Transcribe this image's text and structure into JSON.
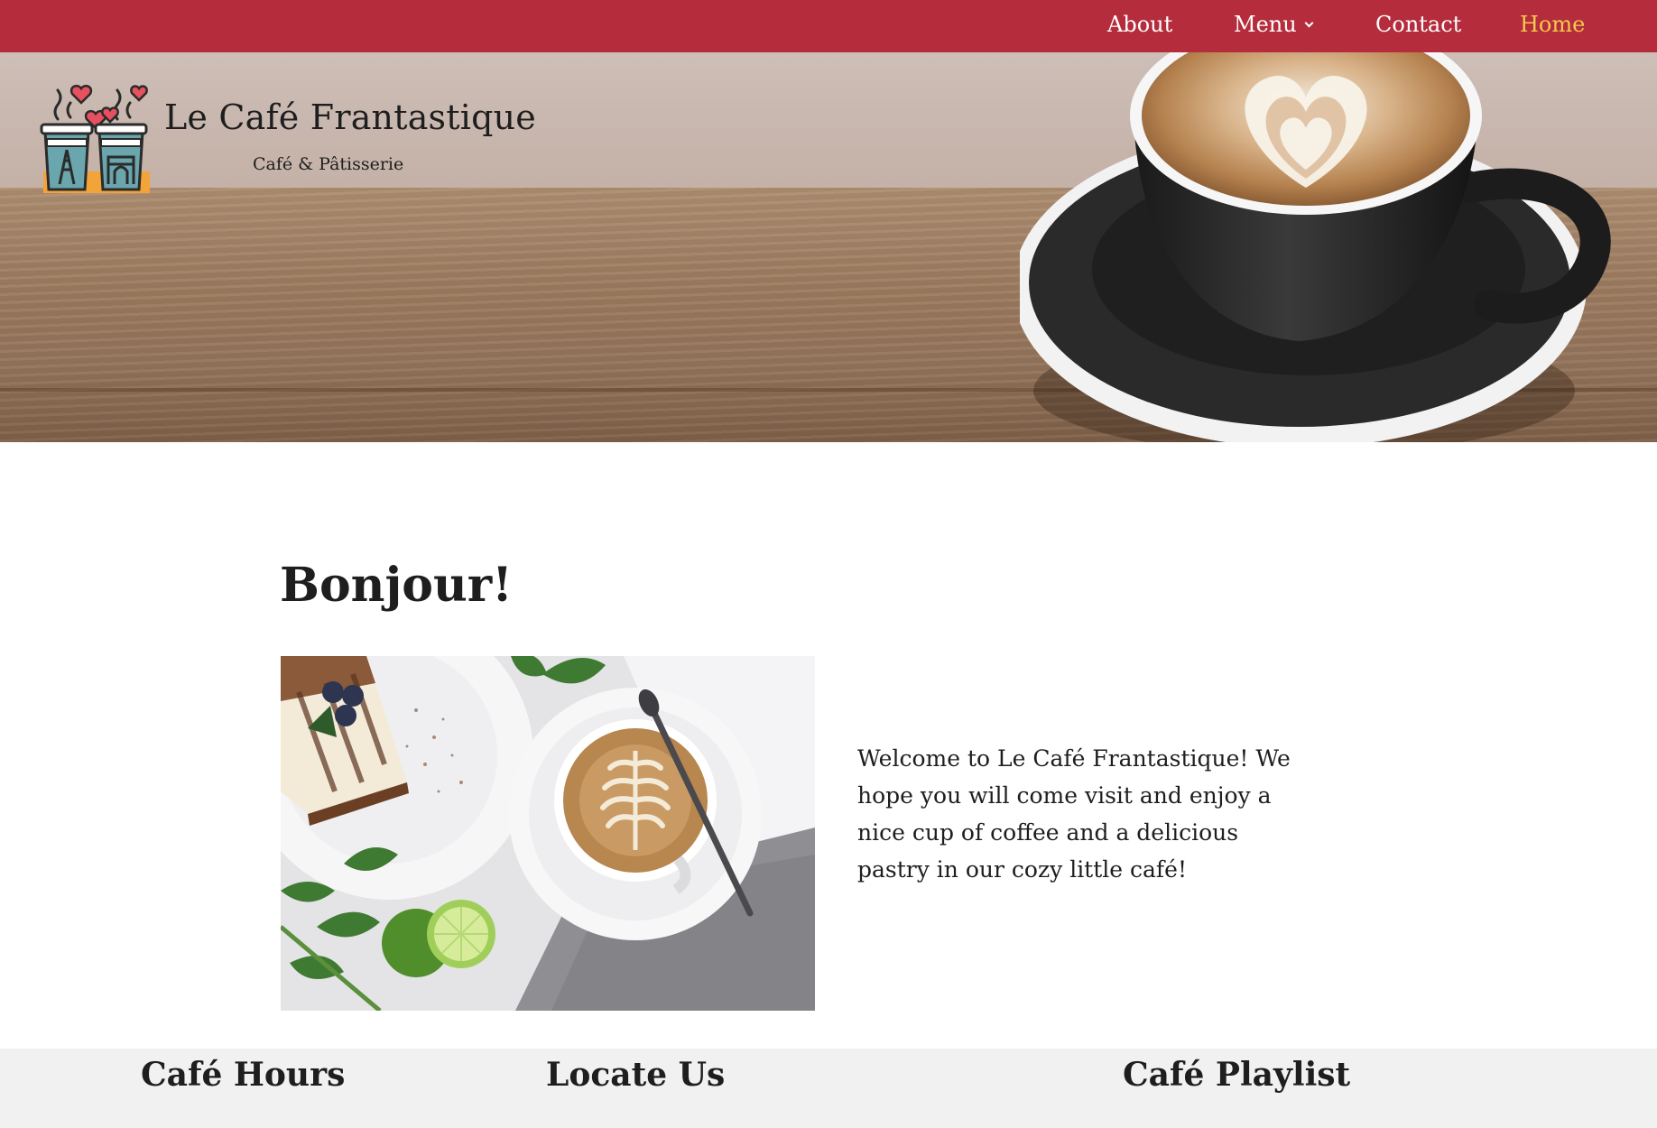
{
  "nav": {
    "items": [
      {
        "label": "About"
      },
      {
        "label": "Menu"
      },
      {
        "label": "Contact"
      },
      {
        "label": "Home"
      }
    ],
    "active": "Home"
  },
  "brand": {
    "title": "Le Café Frantastique",
    "tagline": "Café & Pâtisserie"
  },
  "main": {
    "heading": "Bonjour!",
    "welcome_text": "Welcome to Le Café Frantastique! We hope you will come visit and enjoy a nice cup of coffee and a delicious pastry in our cozy little café!"
  },
  "footer": {
    "headings": [
      "Café Hours",
      "Locate Us",
      "Café Playlist"
    ]
  },
  "colors": {
    "nav_background": "#b52d3d",
    "nav_text": "#ffffff",
    "nav_active": "#f6c94c",
    "footer_background": "#f1f1f1"
  },
  "icons": {
    "logo": "twin-coffee-cups-logo",
    "menu_dropdown": "chevron-down-icon"
  }
}
